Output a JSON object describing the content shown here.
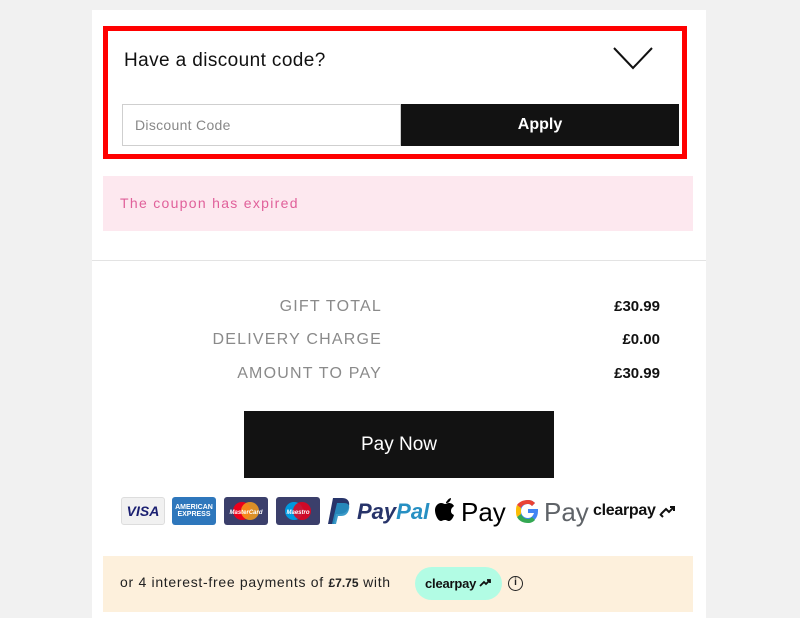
{
  "discount": {
    "title": "Have a discount code?",
    "input_value": "",
    "input_placeholder": "Discount Code",
    "apply_label": "Apply",
    "highlight_color": "#ff0000"
  },
  "error": {
    "message": "The coupon has expired",
    "color": "#e0609a",
    "background": "#fde8ef"
  },
  "summary": [
    {
      "label": "GIFT TOTAL",
      "value": "£30.99"
    },
    {
      "label": "DELIVERY CHARGE",
      "value": "£0.00"
    },
    {
      "label": "AMOUNT TO PAY",
      "value": "£30.99"
    }
  ],
  "pay_now_label": "Pay Now",
  "payment_methods": {
    "visa": "VISA",
    "amex": "AMERICAN EXPRESS",
    "mastercard": "MasterCard",
    "maestro": "Maestro",
    "paypal_a": "Pay",
    "paypal_b": "Pal",
    "apple_pay": "Pay",
    "google_pay": "Pay",
    "clearpay": "clearpay",
    "icons": [
      "visa-icon",
      "amex-icon",
      "mastercard-icon",
      "maestro-icon",
      "paypal-icon",
      "apple-pay-icon",
      "google-pay-icon",
      "clearpay-icon"
    ]
  },
  "installments": {
    "text_before": "or 4 interest-free payments of",
    "amount": "£7.75",
    "text_after": "with",
    "badge": "clearpay",
    "badge_color": "#b2fce4",
    "background": "#fdf0dc"
  }
}
